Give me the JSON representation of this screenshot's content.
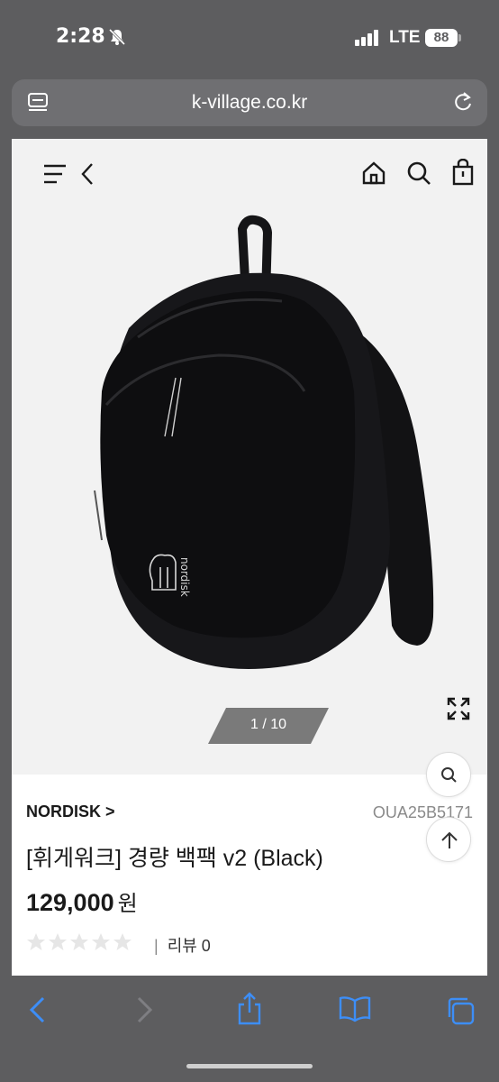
{
  "status_bar": {
    "time": "2:28",
    "network": "LTE",
    "battery": "88"
  },
  "browser": {
    "url": "k-village.co.kr"
  },
  "site_nav": {
    "icons": [
      "menu-icon",
      "back-chevron-icon",
      "home-icon",
      "search-icon",
      "shopping-bag-icon"
    ]
  },
  "gallery": {
    "counter": "1 / 10"
  },
  "product": {
    "brand": "NORDISK >",
    "code": "OUA25B5171",
    "name": "[휘게워크] 경량 백팩 v2 (Black)",
    "price": "129,000",
    "currency": "원",
    "rating": 0,
    "review_label": "리뷰 0"
  },
  "toolbar": {
    "icons": [
      "back-icon",
      "forward-icon",
      "share-icon",
      "bookmarks-icon",
      "tabs-icon"
    ]
  },
  "colors": {
    "chrome": "#5d5d5f",
    "accent": "#3d8ef7",
    "hero_bg": "#f2f2f2"
  }
}
